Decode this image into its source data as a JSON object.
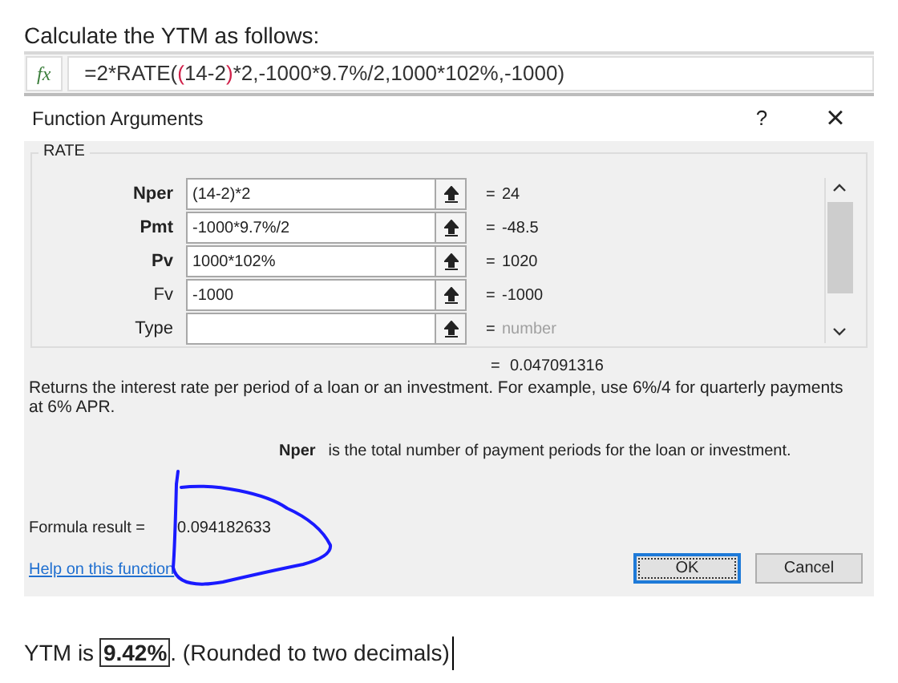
{
  "intro": "Calculate the YTM as follows:",
  "formula_bar": {
    "icon": "fx",
    "segments": [
      {
        "text": "=2*RATE(",
        "highlight": false
      },
      {
        "text": "(",
        "highlight": true
      },
      {
        "text": "14-2",
        "highlight": false
      },
      {
        "text": ")",
        "highlight": true
      },
      {
        "text": "*2,-1000*9.7%/2,1000*102%,-1000)",
        "highlight": false
      }
    ]
  },
  "dialog": {
    "title": "Function Arguments",
    "help_button": "?",
    "close_button": "×",
    "group": "RATE",
    "arguments": [
      {
        "label": "Nper",
        "required": true,
        "value": "(14-2)*2",
        "result": "24",
        "kind": "value"
      },
      {
        "label": "Pmt",
        "required": true,
        "value": "-1000*9.7%/2",
        "result": "-48.5",
        "kind": "value"
      },
      {
        "label": "Pv",
        "required": true,
        "value": "1000*102%",
        "result": "1020",
        "kind": "value"
      },
      {
        "label": "Fv",
        "required": false,
        "value": "-1000",
        "result": "-1000",
        "kind": "value"
      },
      {
        "label": "Type",
        "required": false,
        "result": "number",
        "kind": "hint"
      }
    ],
    "equals": "=",
    "function_result": "0.047091316",
    "description": "Returns the interest rate per period of a loan or an investment. For example, use 6%/4 for quarterly payments at 6% APR.",
    "argument_help": {
      "name": "Nper",
      "text": "is the total number of payment periods for the loan or investment."
    },
    "formula_result_label": "Formula result =",
    "formula_result": "0.094182633",
    "help_link": "Help on this function",
    "buttons": [
      {
        "label": "OK",
        "default": true
      },
      {
        "label": "Cancel",
        "default": false
      }
    ]
  },
  "conclusion": "YTM is **9.42%**. (Rounded to two decimals)"
}
